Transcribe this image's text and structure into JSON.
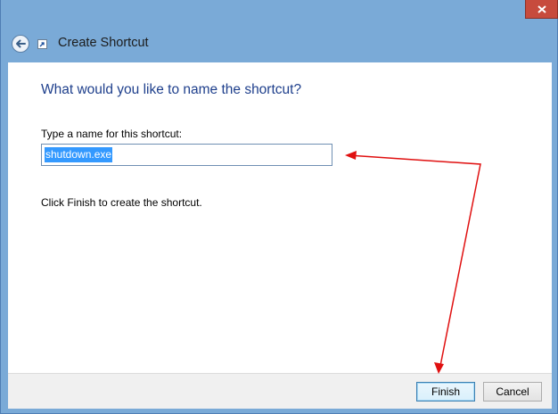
{
  "window": {
    "title": "Create Shortcut"
  },
  "wizard": {
    "heading": "What would you like to name the shortcut?",
    "name_label": "Type a name for this shortcut:",
    "name_value": "shutdown.exe",
    "finish_note": "Click Finish to create the shortcut."
  },
  "footer": {
    "finish_label": "Finish",
    "cancel_label": "Cancel"
  },
  "icons": {
    "close": "close-icon",
    "back": "back-arrow-icon",
    "app": "shortcut-icon"
  },
  "colors": {
    "frame": "#7aaad7",
    "close": "#c74b3d",
    "heading": "#1e3f8c",
    "selection": "#3399ff",
    "annotation": "#e01010"
  }
}
